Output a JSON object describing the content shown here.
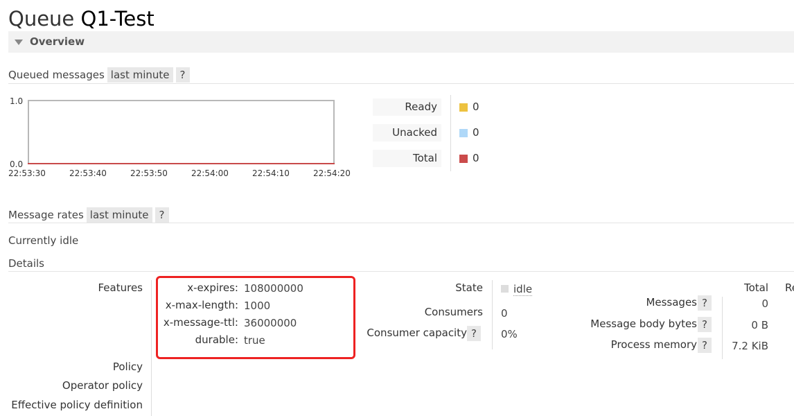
{
  "page": {
    "title_prefix": "Queue",
    "queue_name": "Q1-Test"
  },
  "overview": {
    "label": "Overview"
  },
  "queued_messages": {
    "heading": "Queued messages",
    "range": "last minute",
    "help": "?"
  },
  "chart_data": {
    "type": "line",
    "x": [
      "22:53:30",
      "22:53:40",
      "22:53:50",
      "22:54:00",
      "22:54:10",
      "22:54:20"
    ],
    "series": [
      {
        "name": "Ready",
        "values": [
          0,
          0,
          0,
          0,
          0,
          0
        ],
        "color": "#edc240"
      },
      {
        "name": "Unacked",
        "values": [
          0,
          0,
          0,
          0,
          0,
          0
        ],
        "color": "#afd8f8"
      },
      {
        "name": "Total",
        "values": [
          0,
          0,
          0,
          0,
          0,
          0
        ],
        "color": "#cb4b4b"
      }
    ],
    "ylim": [
      0.0,
      1.0
    ],
    "yticks": [
      "1.0",
      "0.0"
    ],
    "grid": false,
    "legend": "right"
  },
  "legend": [
    {
      "label": "Ready",
      "value": "0",
      "color": "#edc240"
    },
    {
      "label": "Unacked",
      "value": "0",
      "color": "#afd8f8"
    },
    {
      "label": "Total",
      "value": "0",
      "color": "#cb4b4b"
    }
  ],
  "message_rates": {
    "heading": "Message rates",
    "range": "last minute",
    "help": "?",
    "status": "Currently idle"
  },
  "details": {
    "heading": "Details",
    "features_label": "Features",
    "features": [
      {
        "key": "x-expires:",
        "value": "108000000"
      },
      {
        "key": "x-max-length:",
        "value": "1000"
      },
      {
        "key": "x-message-ttl:",
        "value": "36000000"
      },
      {
        "key": "durable:",
        "value": "true"
      }
    ],
    "policy_label": "Policy",
    "operator_policy_label": "Operator policy",
    "effective_policy_label": "Effective policy definition",
    "state_label": "State",
    "state_value": "idle",
    "consumers_label": "Consumers",
    "consumers_value": "0",
    "consumer_capacity_label": "Consumer capacity",
    "consumer_capacity_help": "?",
    "consumer_capacity_value": "0%",
    "total_header": "Total",
    "next_col_header": "Re",
    "messages_label": "Messages",
    "messages_help": "?",
    "messages_value": "0",
    "body_bytes_label": "Message body bytes",
    "body_bytes_help": "?",
    "body_bytes_value": "0 B",
    "process_memory_label": "Process memory",
    "process_memory_help": "?",
    "process_memory_value": "7.2 KiB"
  }
}
